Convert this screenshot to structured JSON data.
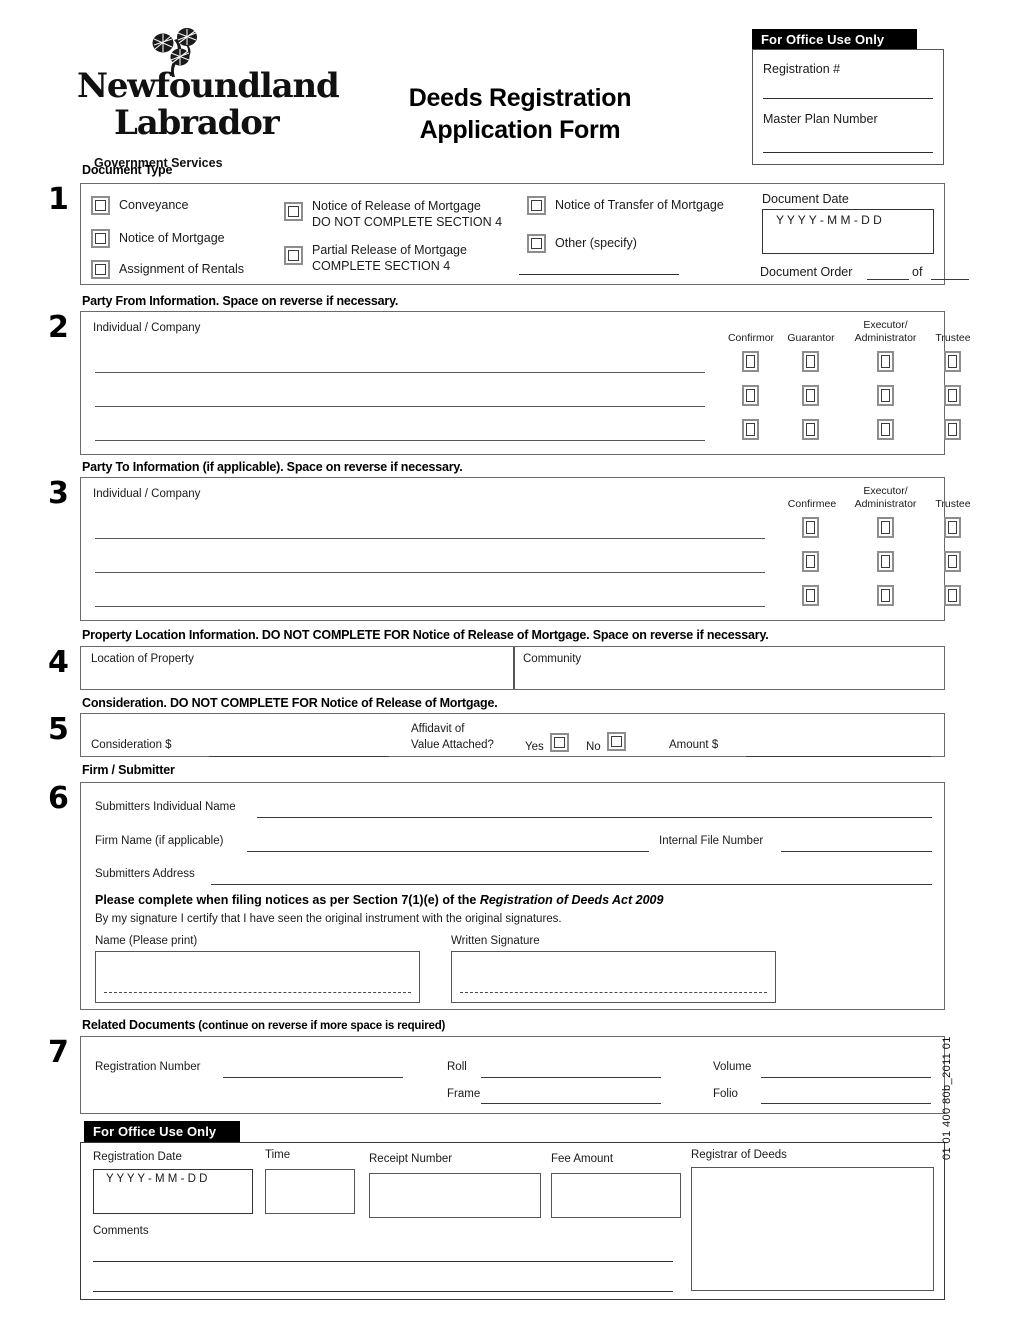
{
  "header": {
    "logo_line1": "Newfoundland",
    "logo_line2": "Labrador",
    "logo_subtitle": "Government Services",
    "title_line1": "Deeds Registration",
    "title_line2": "Application Form",
    "office_use_bar": "For Office Use Only",
    "registration_number_label": "Registration #",
    "master_plan_label": "Master Plan Number"
  },
  "section1": {
    "number": "1",
    "caption": "Document Type",
    "col1": [
      {
        "label": "Conveyance"
      },
      {
        "label": "Notice of Mortgage"
      },
      {
        "label": "Assignment of Rentals"
      }
    ],
    "col2": [
      {
        "label": "Notice of Release of Mortgage",
        "sub": "DO NOT COMPLETE SECTION 4"
      },
      {
        "label": "Partial Release of Mortgage",
        "sub": "COMPLETE SECTION 4"
      }
    ],
    "col3": [
      {
        "label": "Notice of Transfer of Mortgage"
      },
      {
        "label": "Other (specify)"
      }
    ],
    "document_date_label": "Document Date",
    "document_date_mask": "Y Y Y Y  -  M M  -  D D",
    "document_order_label": "Document Order",
    "document_order_of": "of"
  },
  "section2": {
    "number": "2",
    "caption": "Party From Information. Space on reverse if necessary.",
    "field_label": "Individual / Company",
    "columns": [
      "Confirmor",
      "Guarantor",
      "Executor/|Administrator",
      "Trustee"
    ],
    "col_headers": [
      {
        "line1": "",
        "line2": "Confirmor"
      },
      {
        "line1": "",
        "line2": "Guarantor"
      },
      {
        "line1": "Executor/",
        "line2": "Administrator"
      },
      {
        "line1": "",
        "line2": "Trustee"
      }
    ],
    "rows": 3
  },
  "section3": {
    "number": "3",
    "caption": "Party To Information (if applicable). Space on reverse if necessary.",
    "field_label": "Individual / Company",
    "col_headers": [
      {
        "line1": "",
        "line2": "Confirmee"
      },
      {
        "line1": "Executor/",
        "line2": "Administrator"
      },
      {
        "line1": "",
        "line2": "Trustee"
      }
    ],
    "rows": 3
  },
  "section4": {
    "number": "4",
    "caption": "Property Location Information. DO NOT COMPLETE FOR Notice of Release of Mortgage. Space on reverse if necessary.",
    "location_label": "Location of Property",
    "community_label": "Community"
  },
  "section5": {
    "number": "5",
    "caption": "Consideration. DO NOT COMPLETE FOR Notice of Release of Mortgage.",
    "consideration_label": "Consideration  $",
    "affidavit_line1": "Affidavit of",
    "affidavit_line2": "Value Attached?",
    "yes_label": "Yes",
    "no_label": "No",
    "amount_label": "Amount  $"
  },
  "section6": {
    "number": "6",
    "caption": "Firm / Submitter",
    "submitter_name_label": "Submitters Individual Name",
    "firm_name_label": "Firm Name (if applicable)",
    "internal_file_label": "Internal File Number",
    "address_label": "Submitters Address",
    "notice_bold_prefix": "Please complete when filing notices as per Section 7(1)(e) of the ",
    "notice_bold_italic": "Registration of Deeds Act 2009",
    "certify_text": "By my signature I certify that I have seen the original instrument with the original signatures.",
    "name_print_label": "Name (Please print)",
    "signature_label": "Written Signature"
  },
  "section7": {
    "number": "7",
    "caption_bold": "Related Documents",
    "caption_rest": " (continue on reverse if more space is required)",
    "registration_number_label": "Registration Number",
    "roll_label": "Roll",
    "frame_label": "Frame",
    "volume_label": "Volume",
    "folio_label": "Folio"
  },
  "office_bottom": {
    "bar_label": "For Office Use Only",
    "registration_date_label": "Registration Date",
    "registration_date_mask": "Y Y Y Y  -  M M  -  D D",
    "time_label": "Time",
    "receipt_number_label": "Receipt Number",
    "fee_amount_label": "Fee Amount",
    "registrar_label": "Registrar of Deeds",
    "comments_label": "Comments"
  },
  "form_code": "01 01 400 80b_2011 01"
}
